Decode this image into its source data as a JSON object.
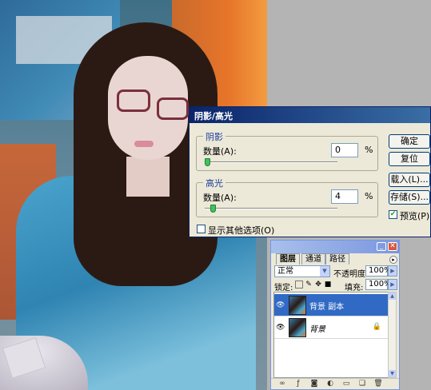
{
  "dialog": {
    "title": "阴影/高光",
    "shadows": {
      "group_title": "阴影",
      "amount_label": "数量(A):",
      "amount_value": "0",
      "unit": "%",
      "slider_value": 0
    },
    "highlights": {
      "group_title": "高光",
      "amount_label": "数量(A):",
      "amount_value": "4",
      "unit": "%",
      "slider_value": 4
    },
    "show_more_label": "显示其他选项(O)",
    "show_more_checked": false,
    "buttons": {
      "ok": "确定",
      "reset": "复位",
      "load": "载入(L)...",
      "save": "存储(S)..."
    },
    "preview_label": "预览(P)",
    "preview_checked": true
  },
  "layers_panel": {
    "tabs": [
      "图层",
      "通道",
      "路径"
    ],
    "blend_mode": "正常",
    "opacity_label": "不透明度:",
    "opacity_value": "100%",
    "lock_label": "锁定:",
    "fill_label": "填充:",
    "fill_value": "100%",
    "layers": [
      {
        "name": "背景 副本",
        "selected": true,
        "visible": true,
        "locked": false
      },
      {
        "name": "背景",
        "selected": false,
        "visible": true,
        "locked": true
      }
    ]
  },
  "icons": {
    "eye": "eye-icon",
    "lock": "lock-icon",
    "minimize": "minimize-icon",
    "close": "close-icon",
    "panel_menu": "panel-menu-icon",
    "check": "check-icon"
  },
  "colors": {
    "dialog_title_bg": "#0a246a",
    "selected_layer": "#316ac5",
    "slider_thumb": "#3cc55a"
  }
}
